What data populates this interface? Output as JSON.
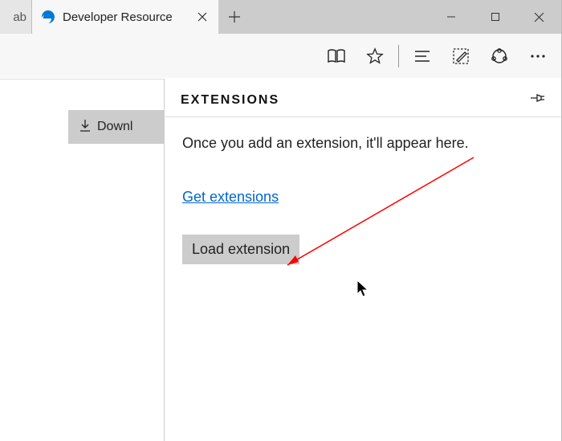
{
  "tabs": {
    "inactive_fragment": "ab",
    "active_title": "Developer Resource"
  },
  "page": {
    "download_label": "Downl"
  },
  "panel": {
    "title": "EXTENSIONS",
    "empty_message": "Once you add an extension, it'll appear here.",
    "get_link_label": "Get extensions",
    "load_button_label": "Load extension"
  }
}
